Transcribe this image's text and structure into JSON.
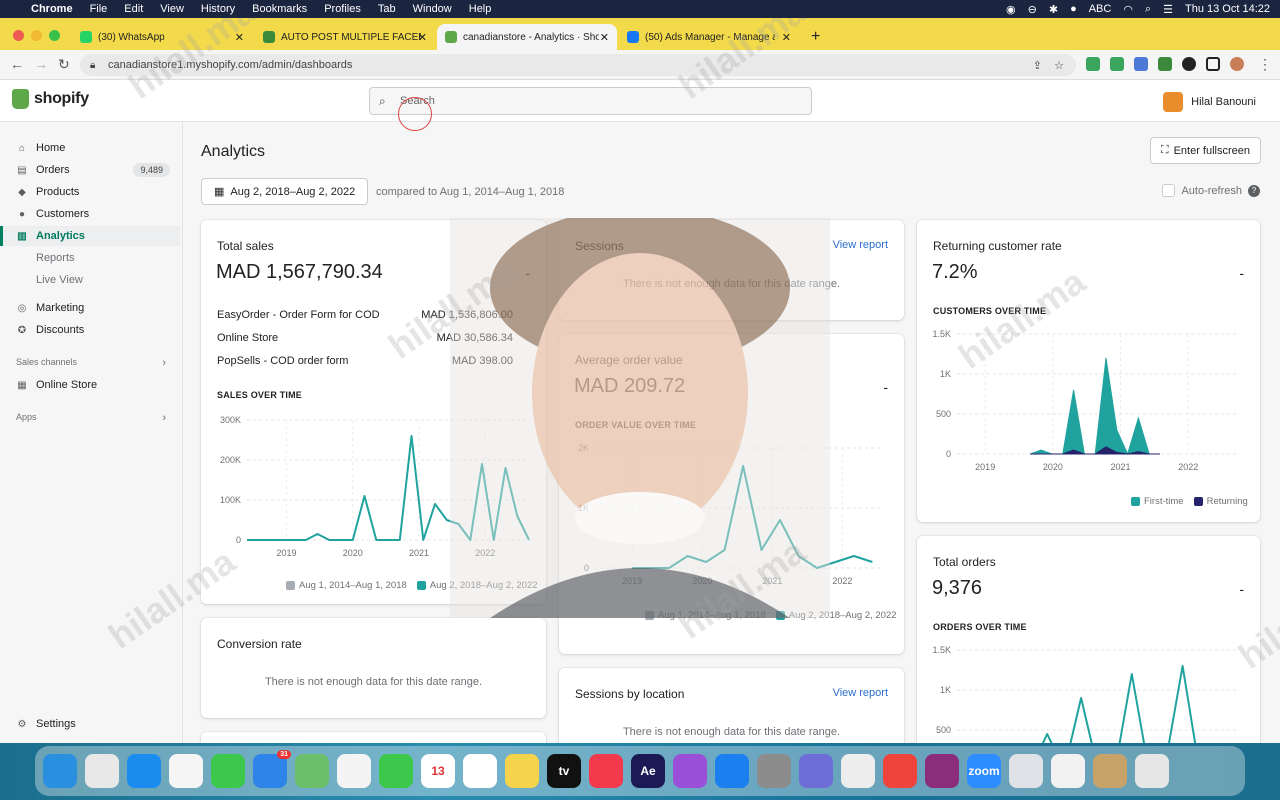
{
  "menubar": {
    "items": [
      "Chrome",
      "File",
      "Edit",
      "View",
      "History",
      "Bookmarks",
      "Profiles",
      "Tab",
      "Window",
      "Help"
    ],
    "keyboard": "ABC",
    "datetime": "Thu 13 Oct  14:22"
  },
  "tabs": [
    {
      "title": "(30) WhatsApp",
      "color": "#25d366"
    },
    {
      "title": "AUTO POST MULTIPLE FACEBO",
      "color": "#3b8a3b"
    },
    {
      "title": "canadianstore - Analytics · Sho",
      "color": "#5fa849"
    },
    {
      "title": "(50) Ads Manager - Manage ad",
      "color": "#1877f2"
    }
  ],
  "new_tab_label": "+",
  "url": "canadianstore1.myshopify.com/admin/dashboards",
  "shopify": {
    "logo_text": "shopify",
    "search_placeholder": "Search",
    "user_name": "Hilal Banouni"
  },
  "sidebar": {
    "items": [
      {
        "label": "Home",
        "icon": "⌂"
      },
      {
        "label": "Orders",
        "icon": "▤",
        "badge": "9,489"
      },
      {
        "label": "Products",
        "icon": "◆"
      },
      {
        "label": "Customers",
        "icon": "●"
      },
      {
        "label": "Analytics",
        "icon": "▥"
      },
      {
        "label": "Reports"
      },
      {
        "label": "Live View"
      },
      {
        "label": "Marketing",
        "icon": "◎"
      },
      {
        "label": "Discounts",
        "icon": "✪"
      }
    ],
    "sales_channels_label": "Sales channels",
    "online_store_label": "Online Store",
    "apps_label": "Apps",
    "settings_label": "Settings"
  },
  "page": {
    "title": "Analytics",
    "fullscreen_label": "Enter fullscreen",
    "date_range": "Aug 2, 2018–Aug 2, 2022",
    "compared_to": "compared to Aug 1, 2014–Aug 1, 2018",
    "auto_refresh": "Auto-refresh"
  },
  "cards": {
    "total_sales": {
      "title": "Total sales",
      "value": "MAD 1,567,790.34",
      "dash": "-",
      "breakdown": [
        {
          "label": "EasyOrder - Order Form for COD",
          "value": "MAD 1,536,806.00"
        },
        {
          "label": "Online Store",
          "value": "MAD 30,586.34"
        },
        {
          "label": "PopSells - COD order form",
          "value": "MAD 398.00"
        }
      ],
      "chart_heading": "SALES OVER TIME",
      "legend": [
        "Aug 1, 2014–Aug 1, 2018",
        "Aug 2, 2018–Aug 2, 2022"
      ]
    },
    "sessions": {
      "title": "Sessions",
      "view_report": "View report",
      "no_data": "There is not enough data for this date range."
    },
    "aov": {
      "title": "Average order value",
      "value": "MAD 209.72",
      "dash": "-",
      "chart_heading": "ORDER VALUE OVER TIME",
      "legend": [
        "Aug 1, 2014–Aug 1, 2018",
        "Aug 2, 2018–Aug 2, 2022"
      ]
    },
    "returning": {
      "title": "Returning customer rate",
      "value": "7.2%",
      "dash": "-",
      "chart_heading": "CUSTOMERS OVER TIME",
      "legend": [
        "First-time",
        "Returning"
      ]
    },
    "conversion": {
      "title": "Conversion rate",
      "no_data": "There is not enough data for this date range."
    },
    "sessions_location": {
      "title": "Sessions by location",
      "view_report": "View report",
      "no_data": "There is not enough data for this date range."
    },
    "total_orders": {
      "title": "Total orders",
      "value": "9,376",
      "dash": "-",
      "chart_heading": "ORDERS OVER TIME"
    }
  },
  "chart_data": [
    {
      "type": "line",
      "x": [
        "2018-08",
        "2018-10",
        "2018-12",
        "2019-02",
        "2019-04",
        "2019-06",
        "2019-08",
        "2019-10",
        "2019-12",
        "2020-02",
        "2020-04",
        "2020-06",
        "2020-08",
        "2020-10",
        "2020-12",
        "2021-02",
        "2021-04",
        "2021-06",
        "2021-08",
        "2021-10",
        "2021-12",
        "2022-02",
        "2022-04",
        "2022-06",
        "2022-08"
      ],
      "series": [
        {
          "values": [
            0,
            0,
            0,
            0,
            0,
            0,
            15000,
            0,
            0,
            0,
            110000,
            0,
            0,
            0,
            260000,
            0,
            90000,
            50000,
            40000,
            0,
            190000,
            0,
            180000,
            60000,
            0
          ]
        }
      ],
      "x_tick_labels": [
        "2019",
        "2020",
        "2021",
        "2022"
      ],
      "y_tick_labels": [
        "0",
        "100K",
        "200K",
        "300K"
      ],
      "ylim": [
        0,
        300000
      ],
      "legend": "bottom"
    },
    {
      "type": "line",
      "x": [
        "2018-08",
        "2019-02",
        "2019-08",
        "2020-02",
        "2020-05",
        "2020-08",
        "2020-10",
        "2021-01",
        "2021-04",
        "2021-07",
        "2021-10",
        "2022-02",
        "2022-06",
        "2022-08"
      ],
      "series": [
        {
          "values": [
            0,
            0,
            0,
            200,
            100,
            300,
            1700,
            300,
            800,
            200,
            0,
            100,
            200,
            100
          ]
        }
      ],
      "x_tick_labels": [
        "2019",
        "2020",
        "2021",
        "2022"
      ],
      "y_tick_labels": [
        "0",
        "1K",
        "2K"
      ],
      "ylim": [
        0,
        2000
      ],
      "legend": "bottom"
    },
    {
      "type": "area",
      "x": [
        "2019-06",
        "2019-09",
        "2019-12",
        "2020-02",
        "2020-04",
        "2020-06",
        "2020-08",
        "2020-10",
        "2020-12",
        "2021-02",
        "2021-04",
        "2021-06",
        "2021-08"
      ],
      "series": [
        {
          "name": "First-time",
          "values": [
            0,
            50,
            0,
            0,
            800,
            0,
            0,
            1200,
            300,
            0,
            450,
            0,
            0
          ]
        },
        {
          "name": "Returning",
          "values": [
            0,
            0,
            0,
            0,
            50,
            0,
            0,
            90,
            20,
            0,
            30,
            0,
            0
          ]
        }
      ],
      "x_tick_labels": [
        "2019",
        "2020",
        "2021",
        "2022"
      ],
      "y_tick_labels": [
        "0",
        "500",
        "1K",
        "1.5K"
      ],
      "ylim": [
        0,
        1500
      ],
      "legend": "bottom-right",
      "colors": [
        "#20a39e",
        "#24236b"
      ]
    },
    {
      "type": "line",
      "x_tick_labels": [],
      "y_tick_labels": [
        "500",
        "1K",
        "1.5K"
      ],
      "ylim": [
        0,
        1500
      ],
      "series": [
        {
          "values": [
            0,
            150,
            0,
            0,
            450,
            0,
            900,
            0,
            0,
            1200,
            0,
            100,
            1300,
            0,
            300,
            200
          ]
        }
      ]
    }
  ],
  "colors": {
    "teal": "#20a39e",
    "grey": "#a5acb3",
    "accent": "#008060",
    "link": "#2c6ecb"
  },
  "dock_apps": [
    {
      "name": "Finder",
      "color": "#2b8fe0"
    },
    {
      "name": "Launchpad",
      "color": "#e8e8e8"
    },
    {
      "name": "Safari",
      "color": "#1a8cf0"
    },
    {
      "name": "Chrome",
      "color": "#f5f5f5"
    },
    {
      "name": "Messages",
      "color": "#3cc84a"
    },
    {
      "name": "Mail",
      "color": "#2e84e8",
      "badge": "31"
    },
    {
      "name": "Maps",
      "color": "#6bbf6b"
    },
    {
      "name": "Photos",
      "color": "#f4f4f4"
    },
    {
      "name": "FaceTime",
      "color": "#3cc84a"
    },
    {
      "name": "Calendar",
      "color": "#ffffff",
      "label": "13"
    },
    {
      "name": "Reminders",
      "color": "#ffffff"
    },
    {
      "name": "Notes",
      "color": "#f5d34a"
    },
    {
      "name": "TV",
      "color": "#111",
      "label": "tv"
    },
    {
      "name": "Music",
      "color": "#f33a4d"
    },
    {
      "name": "After Effects",
      "color": "#1b1a54",
      "label": "Ae"
    },
    {
      "name": "Podcasts",
      "color": "#9b4fd8"
    },
    {
      "name": "App Store",
      "color": "#1b7ff0"
    },
    {
      "name": "Settings",
      "color": "#8c8c8c"
    },
    {
      "name": "Screenshot",
      "color": "#6d6dd8"
    },
    {
      "name": "Script",
      "color": "#ededed"
    },
    {
      "name": "AnyDesk",
      "color": "#ef443b"
    },
    {
      "name": "WinRAR",
      "color": "#8b2d7a"
    },
    {
      "name": "Zoom",
      "color": "#2d8cff",
      "label": "zoom"
    },
    {
      "name": "Disk",
      "color": "#dfe2e6"
    },
    {
      "name": "Window",
      "color": "#f2f2f2"
    },
    {
      "name": "Preview",
      "color": "#c7a36a"
    },
    {
      "name": "Trash",
      "color": "#e6e6e6"
    }
  ],
  "watermark": "hilall.ma"
}
